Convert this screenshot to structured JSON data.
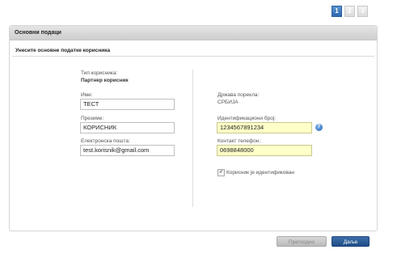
{
  "steps": [
    "1",
    "2",
    "3"
  ],
  "panel": {
    "title": "Основни подаци",
    "section_title": "Унесите основне податке корисника"
  },
  "left": {
    "user_type_label": "Тип корисника:",
    "user_type_value": "Партнер корисник",
    "first_name_label": "Име:",
    "first_name_value": "ТЕСТ",
    "last_name_label": "Презиме:",
    "last_name_value": "КОРИСНИК",
    "email_label": "Електронска пошта:",
    "email_value": "test.korisnik@gmail.com"
  },
  "right": {
    "country_label": "Држава порекла:",
    "country_value": "СРБИЈА",
    "id_number_label": "Идентификациони број:",
    "id_number_value": "1234567891234",
    "phone_label": "Контакт телефон:",
    "phone_value": "0698848000",
    "identified_label": "Корисник је идентификован",
    "help_glyph": "?"
  },
  "buttons": {
    "prev": "Претходно",
    "next": "Даље"
  },
  "colors": {
    "accent": "#2e67ae",
    "required_field": "#ffffc8"
  }
}
